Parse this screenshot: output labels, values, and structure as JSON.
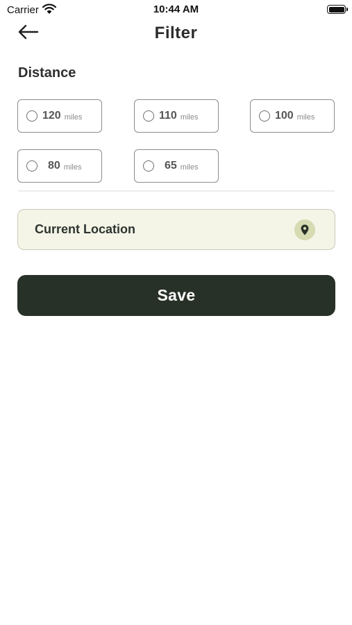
{
  "status_bar": {
    "carrier": "Carrier",
    "time": "10:44 AM"
  },
  "header": {
    "title": "Filter",
    "back_icon": "arrow-left-icon"
  },
  "distance": {
    "title": "Distance",
    "options": [
      {
        "value": "120",
        "unit": "miles",
        "selected": false
      },
      {
        "value": "110",
        "unit": "miles",
        "selected": false
      },
      {
        "value": "100",
        "unit": "miles",
        "selected": false
      },
      {
        "value": "80",
        "unit": "miles",
        "selected": false
      },
      {
        "value": "65",
        "unit": "miles",
        "selected": false
      }
    ]
  },
  "location": {
    "label": "Current Location",
    "icon": "map-pin-icon"
  },
  "actions": {
    "save_label": "Save"
  },
  "colors": {
    "primary_dark": "#283127",
    "location_bg": "#f4f5e7",
    "pin_bg": "#d6dbb2"
  }
}
